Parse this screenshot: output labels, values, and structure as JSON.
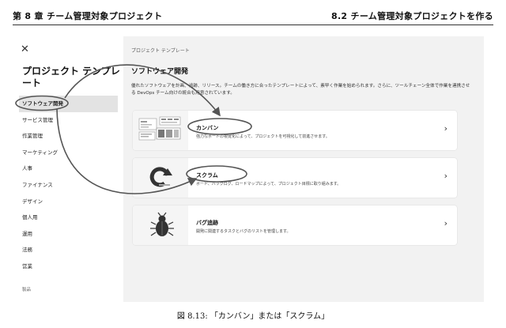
{
  "page_header": {
    "chapter": "第 8 章 チーム管理対象プロジェクト",
    "section": "8.2 チーム管理対象プロジェクトを作る"
  },
  "sidebar": {
    "title": "プロジェクト テンプレート",
    "items": [
      {
        "label": "ソフトウェア開発",
        "active": true
      },
      {
        "label": "サービス管理"
      },
      {
        "label": "作業管理"
      },
      {
        "label": "マーケティング"
      },
      {
        "label": "人事"
      },
      {
        "label": "ファイナンス"
      },
      {
        "label": "デザイン"
      },
      {
        "label": "個人用"
      },
      {
        "label": "運用"
      },
      {
        "label": "法務"
      },
      {
        "label": "営業"
      }
    ],
    "group_label": "製品"
  },
  "main": {
    "breadcrumb": "プロジェクト テンプレート",
    "title": "ソフトウェア開発",
    "description": "優れたソフトウェアを計画、追跡、リリース。チームの働き方に合ったテンプレートによって、素早く作業を始められます。さらに、ツールチェーン全体で作業を連携させる DevOps チーム向けの統合も用意されています。",
    "templates": [
      {
        "name": "カンバン",
        "description": "強力なボードの視覚化によって、プロジェクトを可視化して前進させます。",
        "icon": "kanban-board-icon"
      },
      {
        "name": "スクラム",
        "description": "ボード、バックログ、ロードマップによって、プロジェクト目標に取り組みます。",
        "icon": "sprint-cycle-icon"
      },
      {
        "name": "バグ追跡",
        "description": "開発に関連するタスクとバグのリストを管理します。",
        "icon": "bug-icon"
      }
    ]
  },
  "caption": "図 8.13: 「カンバン」または「スクラム」",
  "colors": {
    "panel_bg": "#f2f2f2",
    "active_bg": "#e3e3e3",
    "annotation": "#555555"
  }
}
